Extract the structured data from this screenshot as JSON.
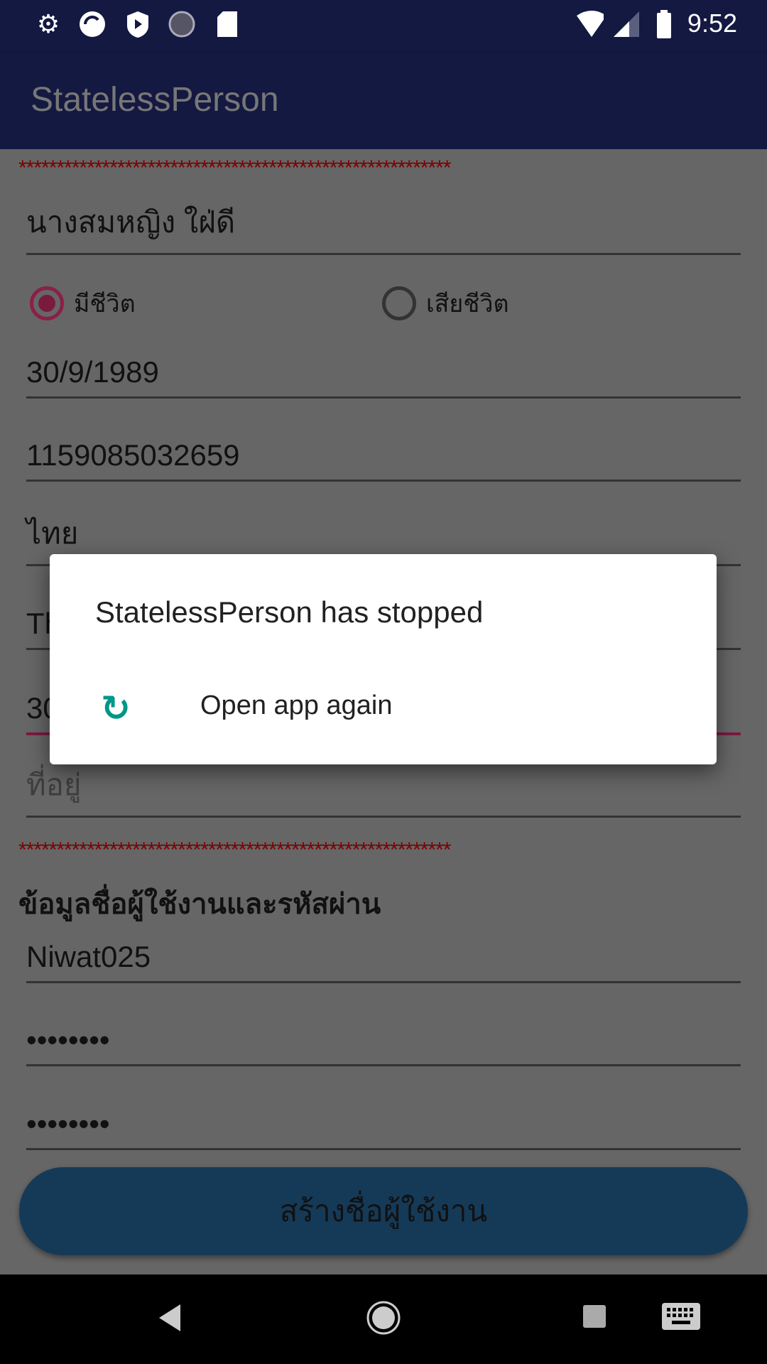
{
  "status_bar": {
    "time": "9:52",
    "icons": [
      "gear-icon",
      "sync-app-icon",
      "shield-play-icon",
      "loading-icon",
      "sd-card-icon",
      "wifi-icon",
      "signal-icon",
      "battery-icon"
    ]
  },
  "app_bar": {
    "title": "StatelessPerson"
  },
  "form": {
    "separator": "*********************************************************",
    "name": "นางสมหญิง ใฝ่ดี",
    "radio_alive": "มีชีวิต",
    "radio_dead": "เสียชีวิต",
    "alive_selected": true,
    "birthdate": "30/9/1989",
    "id_number": "1159085032659",
    "nationality": "ไทย",
    "field5_partial": "Th",
    "field6_partial": "30",
    "address_hint": "ที่อยู่",
    "account_heading": "ข้อมูลชื่อผู้ใช้งานและรหัสผ่าน",
    "username": "Niwat025",
    "password": "••••••••",
    "confirm_password": "••••••••",
    "create_button": "สร้างชื่อผู้ใช้งาน"
  },
  "dialog": {
    "title": "StatelessPerson has stopped",
    "action": "Open app again"
  },
  "colors": {
    "app_bar": "#141942",
    "accent": "#d81b60",
    "button": "#2196f3",
    "dialog_icon": "#009688"
  }
}
